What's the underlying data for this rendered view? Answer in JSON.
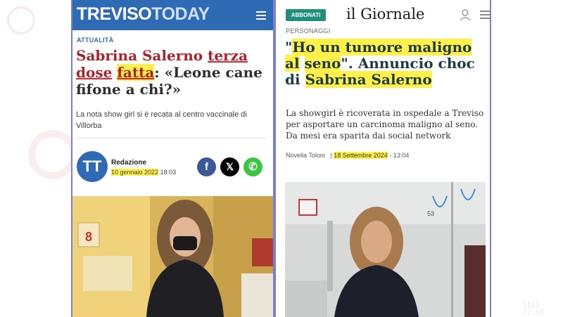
{
  "background": {
    "stamp": "1111 72:37"
  },
  "left": {
    "logo_bold": "TREVISO",
    "logo_light": "TODAY",
    "category": "ATTUALITÀ",
    "title_part1": "Sabrina Salerno ",
    "title_part2": "terza dose",
    "title_part3": "fatta",
    "title_part4": ": «Leone cane fifone a chi?»",
    "lead": "La nota show girl si è recata al centro vaccinale di Villorba",
    "avatar_initials": "TT",
    "author": "Redazione",
    "date": "10 gennaio 2022",
    "time": "18:03",
    "share": {
      "facebook": "f",
      "x": "𝕏",
      "whatsapp": "✆"
    },
    "photo": {
      "sign_number": "8"
    }
  },
  "right": {
    "subscribe_label": "ABBONATI",
    "logo": "il Giornale",
    "category": "PERSONAGGI",
    "title_quote_open": "\"",
    "title_highlight1": "Ho un tumore maligno al",
    "title_highlight2": "seno",
    "title_mid": "\". Annuncio choc di",
    "title_highlight3": "Sabrina Salerno",
    "lead": "La showgirl è ricoverata in ospedale a Treviso per asportare un carcinoma maligno al seno. Da mesi era sparita dai social network",
    "author": "Novella Toloni",
    "separator": "|",
    "date": "18 Settembre 2024",
    "time": "- 13:04",
    "photo": {
      "room_number": "53"
    }
  },
  "colors": {
    "treviso_blue": "#2f6ab4",
    "highlight_yellow": "#fff04a",
    "title_red": "#a8232c",
    "giornale_teal": "#1f8f7b"
  }
}
